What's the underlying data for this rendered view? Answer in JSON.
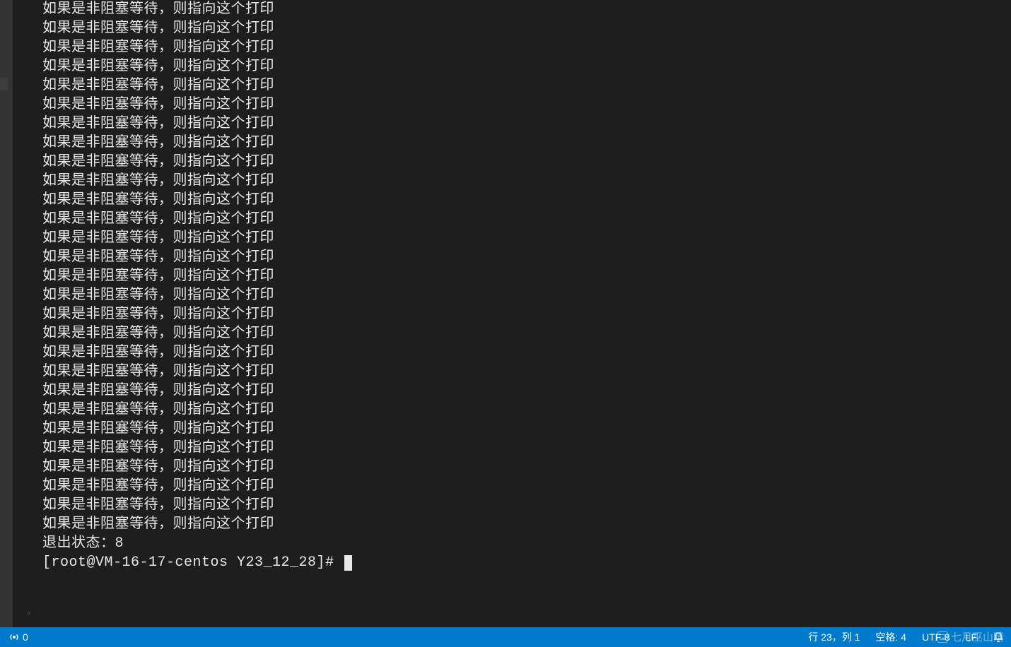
{
  "terminal": {
    "repeated_line": "如果是非阻塞等待，则指向这个打印",
    "repeat_count": 28,
    "exit_status_line": "退出状态：8",
    "prompt": "[root@VM-16-17-centos Y23_12_28]# "
  },
  "statusbar": {
    "remote": {
      "count": "0"
    },
    "line_col": "行 23，列 1",
    "indent": "空格: 4",
    "encoding": "UTF-8",
    "eol": "LF"
  },
  "watermark": "七月巫山晴"
}
